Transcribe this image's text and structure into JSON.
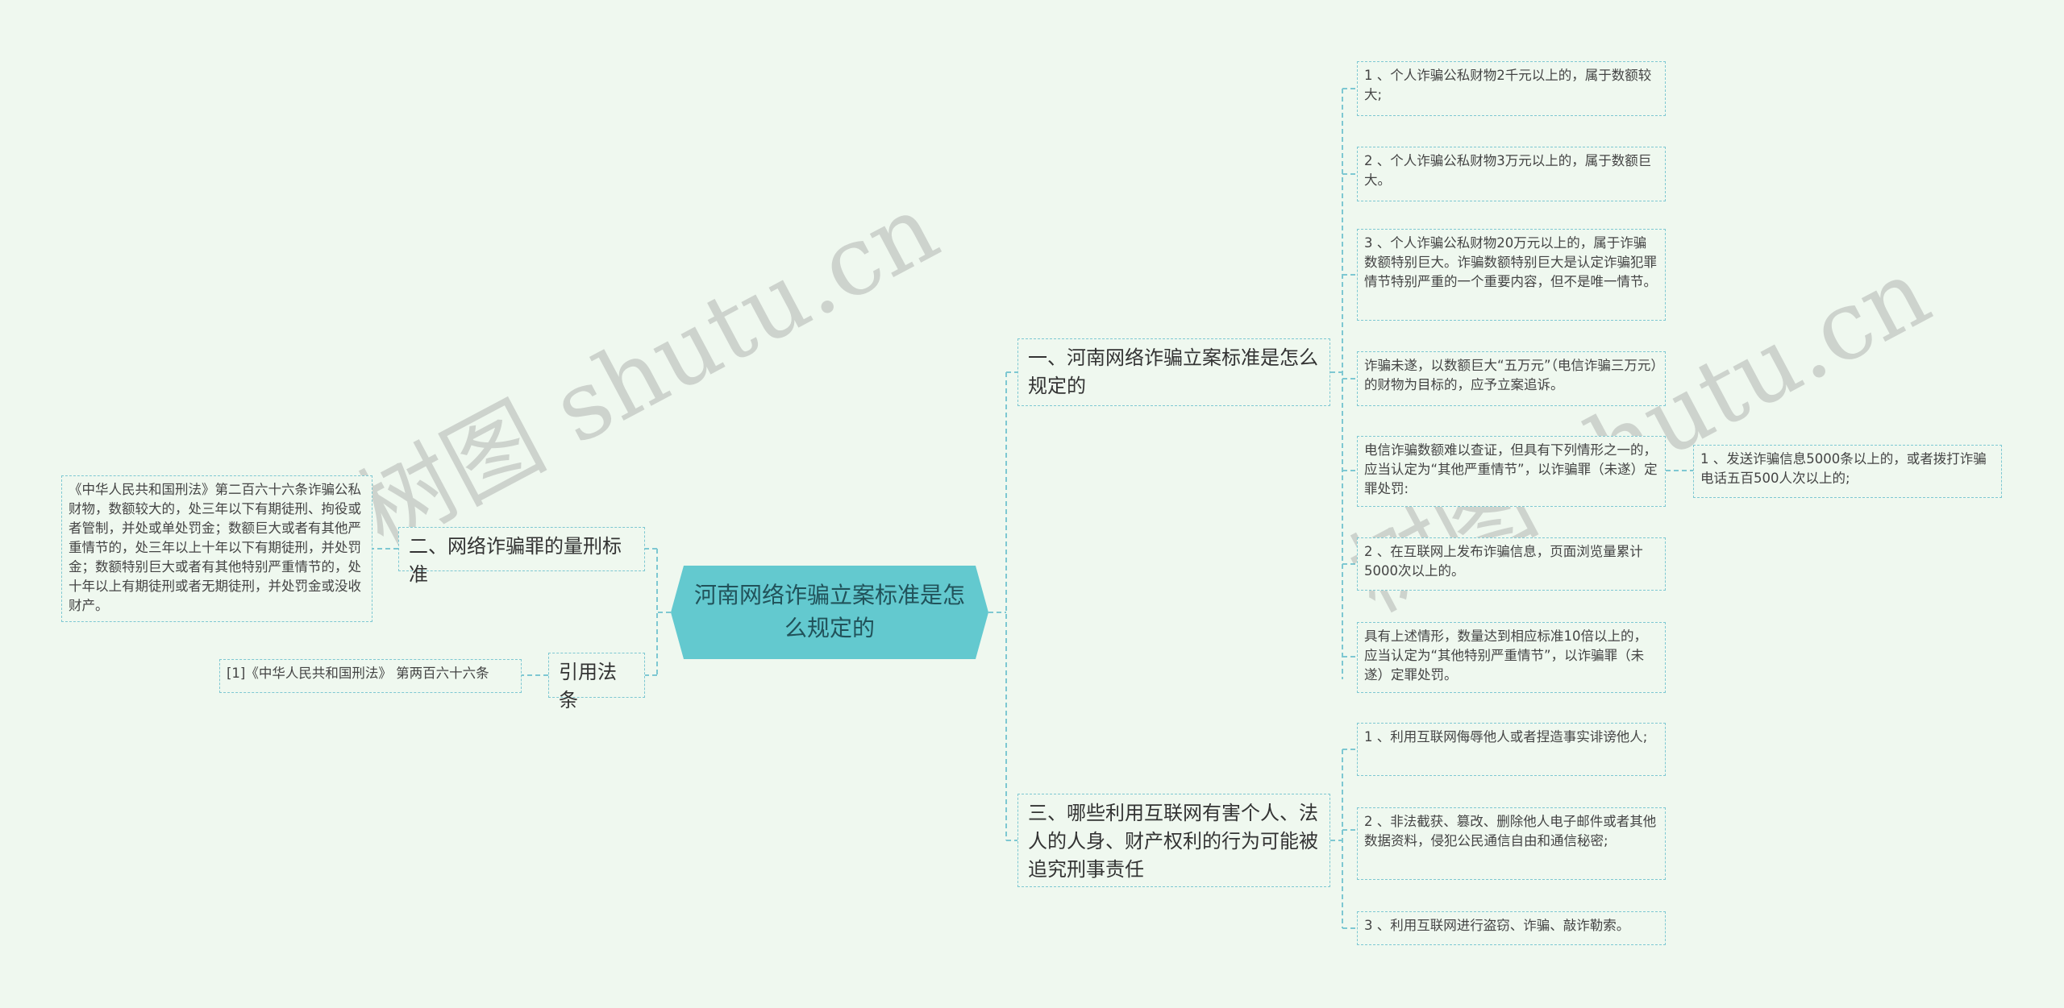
{
  "root": {
    "title": "河南网络诈骗立案标准是怎么规定的"
  },
  "branches": {
    "b1": {
      "label": "一、河南网络诈骗立案标准是怎么规定的"
    },
    "b2": {
      "label": "二、网络诈骗罪的量刑标准"
    },
    "b3": {
      "label": "三、哪些利用互联网有害个人、法人的人身、财产权利的行为可能被追究刑事责任"
    },
    "b4": {
      "label": "引用法条"
    }
  },
  "leaves": {
    "b1_1": "1 、个人诈骗公私财物2千元以上的，属于数额较大;",
    "b1_2": "2 、个人诈骗公私财物3万元以上的，属于数额巨大。",
    "b1_3": "3 、个人诈骗公私财物20万元以上的，属于诈骗数额特别巨大。诈骗数额特别巨大是认定诈骗犯罪情节特别严重的一个重要内容，但不是唯一情节。",
    "b1_4": "诈骗未遂，以数额巨大“五万元”（电信诈骗三万元）的财物为目标的，应予立案追诉。",
    "b1_5": "电信诈骗数额难以查证，但具有下列情形之一的，应当认定为“其他严重情节”，以诈骗罪（未遂）定罪处罚:",
    "b1_5_1": "1 、发送诈骗信息5000条以上的，或者拨打诈骗电话五百500人次以上的;",
    "b1_6": "2 、在互联网上发布诈骗信息，页面浏览量累计5000次以上的。",
    "b1_7": "具有上述情形，数量达到相应标准10倍以上的，应当认定为“其他特别严重情节”，以诈骗罪（未遂）定罪处罚。",
    "b2_1": "《中华人民共和国刑法》第二百六十六条诈骗公私财物，数额较大的，处三年以下有期徒刑、拘役或者管制，并处或单处罚金；数额巨大或者有其他严重情节的，处三年以上十年以下有期徒刑，并处罚金；数额特别巨大或者有其他特别严重情节的，处十年以上有期徒刑或者无期徒刑，并处罚金或没收财产。",
    "b3_1": "1 、利用互联网侮辱他人或者捏造事实诽谤他人;",
    "b3_2": "2 、非法截获、篡改、删除他人电子邮件或者其他数据资料，侵犯公民通信自由和通信秘密;",
    "b3_3": "3 、利用互联网进行盗窃、诈骗、敲诈勒索。",
    "b4_1": "[1]《中华人民共和国刑法》 第两百六十六条"
  },
  "watermarks": [
    "树图 shutu.cn",
    "树图 shutu.cn"
  ],
  "colors": {
    "background": "#eff8ef",
    "root_fill": "#63c9cf",
    "connector": "#7ec8d2"
  }
}
